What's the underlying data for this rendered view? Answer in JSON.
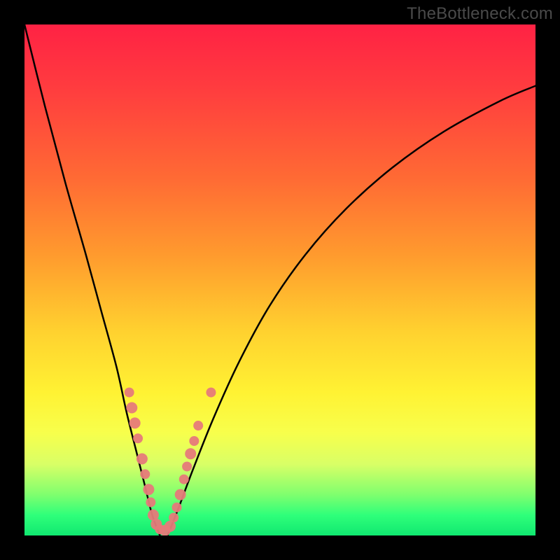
{
  "watermark": "TheBottleneck.com",
  "chart_data": {
    "type": "line",
    "title": "",
    "xlabel": "",
    "ylabel": "",
    "xlim": [
      0,
      100
    ],
    "ylim": [
      0,
      100
    ],
    "grid": false,
    "legend": false,
    "background_gradient": {
      "top": "#ff2244",
      "bottom": "#10e870"
    },
    "series": [
      {
        "name": "left-curve",
        "x": [
          0,
          4,
          8,
          12,
          15,
          18,
          20,
          22,
          23.5,
          25,
          26.5
        ],
        "y": [
          100,
          84,
          69,
          55,
          44,
          33,
          24,
          16,
          10,
          4,
          0
        ]
      },
      {
        "name": "right-curve",
        "x": [
          28,
          30,
          33,
          37,
          42,
          48,
          55,
          63,
          72,
          82,
          93,
          100
        ],
        "y": [
          0,
          5,
          13,
          23,
          34,
          45,
          55,
          64,
          72,
          79,
          85,
          88
        ]
      }
    ],
    "markers": [
      {
        "x": 20.5,
        "y": 28,
        "r": 7
      },
      {
        "x": 21.0,
        "y": 25,
        "r": 8
      },
      {
        "x": 21.6,
        "y": 22,
        "r": 8
      },
      {
        "x": 22.2,
        "y": 19,
        "r": 7
      },
      {
        "x": 23.0,
        "y": 15,
        "r": 8
      },
      {
        "x": 23.6,
        "y": 12,
        "r": 7
      },
      {
        "x": 24.3,
        "y": 9,
        "r": 8
      },
      {
        "x": 24.7,
        "y": 6.5,
        "r": 7
      },
      {
        "x": 25.2,
        "y": 4,
        "r": 8
      },
      {
        "x": 25.8,
        "y": 2.2,
        "r": 8
      },
      {
        "x": 26.5,
        "y": 1.2,
        "r": 7
      },
      {
        "x": 27.5,
        "y": 1.0,
        "r": 8
      },
      {
        "x": 28.5,
        "y": 1.8,
        "r": 8
      },
      {
        "x": 29.2,
        "y": 3.5,
        "r": 7
      },
      {
        "x": 29.8,
        "y": 5.5,
        "r": 7
      },
      {
        "x": 30.5,
        "y": 8,
        "r": 8
      },
      {
        "x": 31.2,
        "y": 11,
        "r": 7
      },
      {
        "x": 31.8,
        "y": 13.5,
        "r": 7
      },
      {
        "x": 32.5,
        "y": 16,
        "r": 8
      },
      {
        "x": 33.2,
        "y": 18.5,
        "r": 7
      },
      {
        "x": 34.0,
        "y": 21.5,
        "r": 7
      },
      {
        "x": 36.5,
        "y": 28,
        "r": 7
      }
    ]
  }
}
